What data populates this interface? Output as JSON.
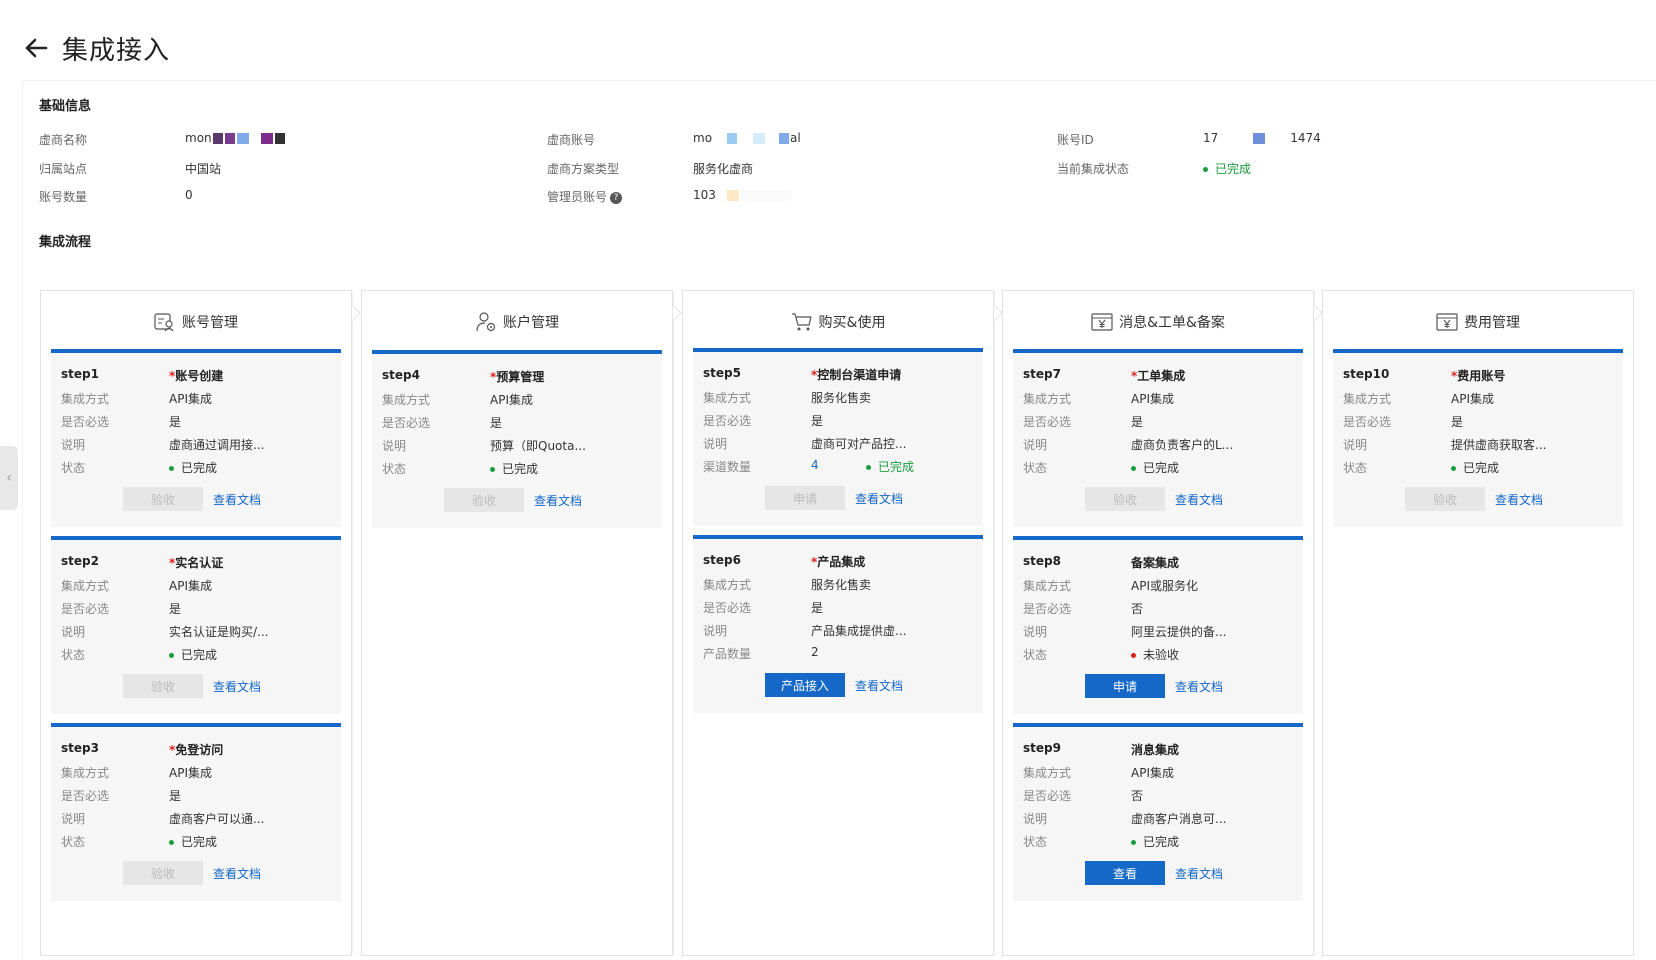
{
  "page": {
    "title": "集成接入"
  },
  "basic": {
    "title": "基础信息",
    "fields": [
      {
        "label": "虚商名称",
        "value": "mon"
      },
      {
        "label": "虚商账号",
        "value": "mo",
        "value_suffix": "al"
      },
      {
        "label": "账号ID",
        "value": "17",
        "value_suffix": "1474"
      },
      {
        "label": "归属站点",
        "value": "中国站"
      },
      {
        "label": "虚商方案类型",
        "value": "服务化虚商"
      },
      {
        "label": "当前集成状态",
        "value": "已完成"
      },
      {
        "label": "账号数量",
        "value": "0"
      },
      {
        "label": "管理员账号",
        "value": "103"
      }
    ]
  },
  "flow": {
    "title": "集成流程",
    "doc_label": "查看文档",
    "columns": [
      {
        "title": "账号管理",
        "icon": "account-id-icon"
      },
      {
        "title": "账户管理",
        "icon": "user-settings-icon"
      },
      {
        "title": "购买&使用",
        "icon": "cart-icon"
      },
      {
        "title": "消息&工单&备案",
        "icon": "yen-box-icon"
      },
      {
        "title": "费用管理",
        "icon": "yen-box-icon"
      }
    ],
    "labels": {
      "method": "集成方式",
      "required": "是否必选",
      "desc": "说明",
      "status": "状态"
    },
    "steps": [
      {
        "id": "step1",
        "name": "账号创建",
        "req": "*",
        "method": "API集成",
        "required": "是",
        "desc": "虚商通过调用接...",
        "status": "已完成",
        "button": "验收"
      },
      {
        "id": "step2",
        "name": "实名认证",
        "req": "*",
        "method": "API集成",
        "required": "是",
        "desc": "实名认证是购买/...",
        "status": "已完成",
        "button": "验收"
      },
      {
        "id": "step3",
        "name": "免登访问",
        "req": "*",
        "method": "API集成",
        "required": "是",
        "desc": "虚商客户可以通...",
        "status": "已完成",
        "button": "验收"
      },
      {
        "id": "step4",
        "name": "预算管理",
        "req": "*",
        "method": "API集成",
        "required": "是",
        "desc": "预算（即Quota...",
        "status": "已完成",
        "button": "验收"
      },
      {
        "id": "step5",
        "name": "控制台渠道申请",
        "req": "*",
        "method": "服务化售卖",
        "required": "是",
        "desc": "虚商可对产品控...",
        "count_label": "渠道数量",
        "count": "4",
        "status": "已完成",
        "button": "申请"
      },
      {
        "id": "step6",
        "name": "产品集成",
        "req": "*",
        "method": "服务化售卖",
        "required": "是",
        "desc": "产品集成提供虚...",
        "count_label": "产品数量",
        "count": "2",
        "button": "产品接入"
      },
      {
        "id": "step7",
        "name": "工单集成",
        "req": "*",
        "method": "API集成",
        "required": "是",
        "desc": "虚商负责客户的L...",
        "status": "已完成",
        "button": "验收"
      },
      {
        "id": "step8",
        "name": "备案集成",
        "req": "",
        "method": "API或服务化",
        "required": "否",
        "desc": "阿里云提供的备...",
        "status": "未验收",
        "button": "申请"
      },
      {
        "id": "step9",
        "name": "消息集成",
        "req": "",
        "method": "API集成",
        "required": "否",
        "desc": "虚商客户消息可...",
        "status": "已完成",
        "button": "查看"
      },
      {
        "id": "step10",
        "name": "费用账号",
        "req": "*",
        "method": "API集成",
        "required": "是",
        "desc": "提供虚商获取客...",
        "status": "已完成",
        "button": "验收"
      }
    ]
  },
  "colors": {
    "accent": "#1567c8",
    "success": "#1a9c3e",
    "danger": "#e02020"
  }
}
